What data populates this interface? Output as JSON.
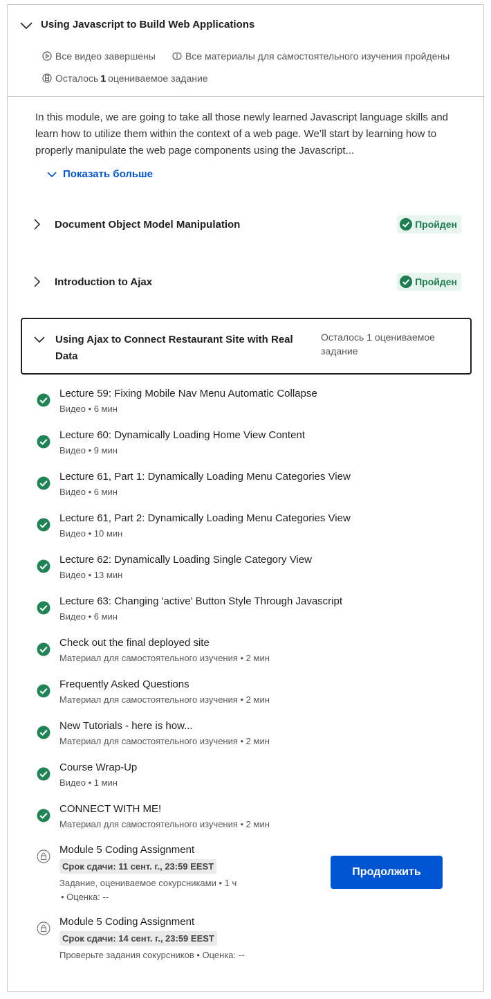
{
  "module": {
    "title": "Using Javascript to Build Web Applications",
    "stat_videos": "Все видео завершены",
    "stat_readings": "Все материалы для самостоятельного изучения пройдены",
    "stat_graded_prefix": "Осталось",
    "stat_graded_count": "1",
    "stat_graded_suffix": "оцениваемое задание",
    "description": "In this module, we are going to take all those newly learned Javascript language skills and learn how to utilize them within the context of a web page. We’ll start by learning how to properly manipulate the web page components using the Javascript...",
    "show_more": "Показать больше"
  },
  "lessons": [
    {
      "title": "Document Object Model Manipulation",
      "status": "Пройден"
    },
    {
      "title": "Introduction to Ajax",
      "status": "Пройден"
    }
  ],
  "active_lesson": {
    "title": "Using Ajax to Connect Restaurant Site with Real Data",
    "remaining": "Осталось 1 оцениваемое задание"
  },
  "items": [
    {
      "title": "Lecture 59: Fixing Mobile Nav Menu Automatic Collapse",
      "meta": "Видео • 6 мин",
      "icon": "check-circle-icon"
    },
    {
      "title": "Lecture 60: Dynamically Loading Home View Content",
      "meta": "Видео • 9 мин",
      "icon": "check-circle-icon"
    },
    {
      "title": "Lecture 61, Part 1: Dynamically Loading Menu Categories View",
      "meta": "Видео • 6 мин",
      "icon": "check-circle-icon"
    },
    {
      "title": "Lecture 61, Part 2: Dynamically Loading Menu Categories View",
      "meta": "Видео • 10 мин",
      "icon": "check-circle-icon"
    },
    {
      "title": "Lecture 62: Dynamically Loading Single Category View",
      "meta": "Видео • 13 мин",
      "icon": "check-circle-icon"
    },
    {
      "title": "Lecture 63: Changing 'active' Button Style Through Javascript",
      "meta": "Видео • 6 мин",
      "icon": "check-circle-icon"
    },
    {
      "title": "Check out the final deployed site",
      "meta": "Материал для самостоятельного изучения • 2 мин",
      "icon": "check-circle-icon"
    },
    {
      "title": "Frequently Asked Questions",
      "meta": "Материал для самостоятельного изучения • 2 мин",
      "icon": "check-circle-icon"
    },
    {
      "title": "New Tutorials - here is how...",
      "meta": "Материал для самостоятельного изучения • 2 мин",
      "icon": "check-circle-icon"
    },
    {
      "title": "Course Wrap-Up",
      "meta": "Видео • 1 мин",
      "icon": "check-circle-icon"
    },
    {
      "title": "CONNECT WITH ME!",
      "meta": "Материал для самостоятельного изучения • 2 мин",
      "icon": "check-circle-icon"
    }
  ],
  "assignments": [
    {
      "title": "Module 5 Coding Assignment",
      "deadline": "Срок сдачи: 11 сент. г., 23:59 EEST",
      "meta_line1": "Задание, оцениваемое сокурсниками • 1 ч",
      "meta_line2": "• Оценка: --",
      "icon": "lock-icon"
    },
    {
      "title": "Module 5 Coding Assignment",
      "deadline": "Срок сдачи: 14 сент. г., 23:59 EEST",
      "meta_line1": "Проверьте задания сокурсников • Оценка: --",
      "icon": "lock-icon"
    }
  ],
  "continue_button": "Продолжить",
  "colors": {
    "accent": "#0056d2",
    "success": "#1d7c50",
    "success_bg": "#e8f4ee",
    "check": "#1f8354"
  }
}
